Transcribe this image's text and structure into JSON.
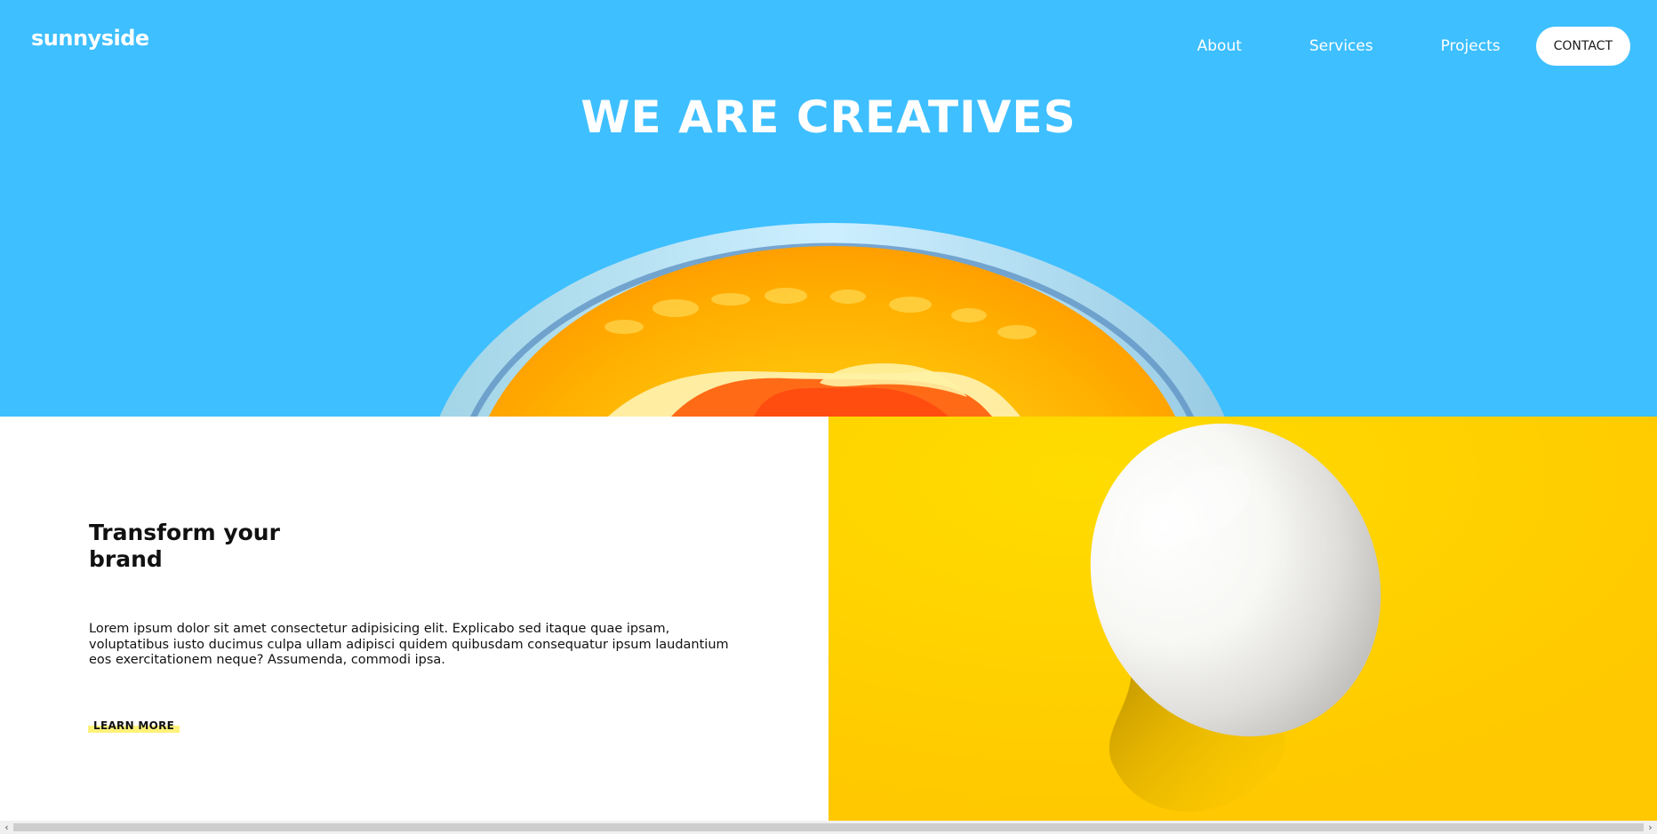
{
  "header": {
    "logo": "sunnyside",
    "nav": [
      {
        "label": "About"
      },
      {
        "label": "Services"
      },
      {
        "label": "Projects"
      }
    ],
    "contact_label": "CONTACT"
  },
  "hero": {
    "title": "WE ARE CREATIVES"
  },
  "feature": {
    "title": "Transform your brand",
    "description": "Lorem ipsum dolor sit amet consectetur adipisicing elit. Explicabo sed itaque quae ipsam, voluptatibus iusto ducimus culpa ullam adipisci quidem quibusdam consequatur ipsum laudantium eos exercitationem neque? Assumenda, commodi ipsa.",
    "cta_label": "LEARN MORE"
  },
  "scrollbar": {
    "left_arrow": "‹",
    "right_arrow": "›"
  },
  "colors": {
    "hero_blue": "#3ebfff",
    "egg_yellow": "#ffd200",
    "learn_more_highlight": "#fff27a",
    "white": "#ffffff"
  }
}
